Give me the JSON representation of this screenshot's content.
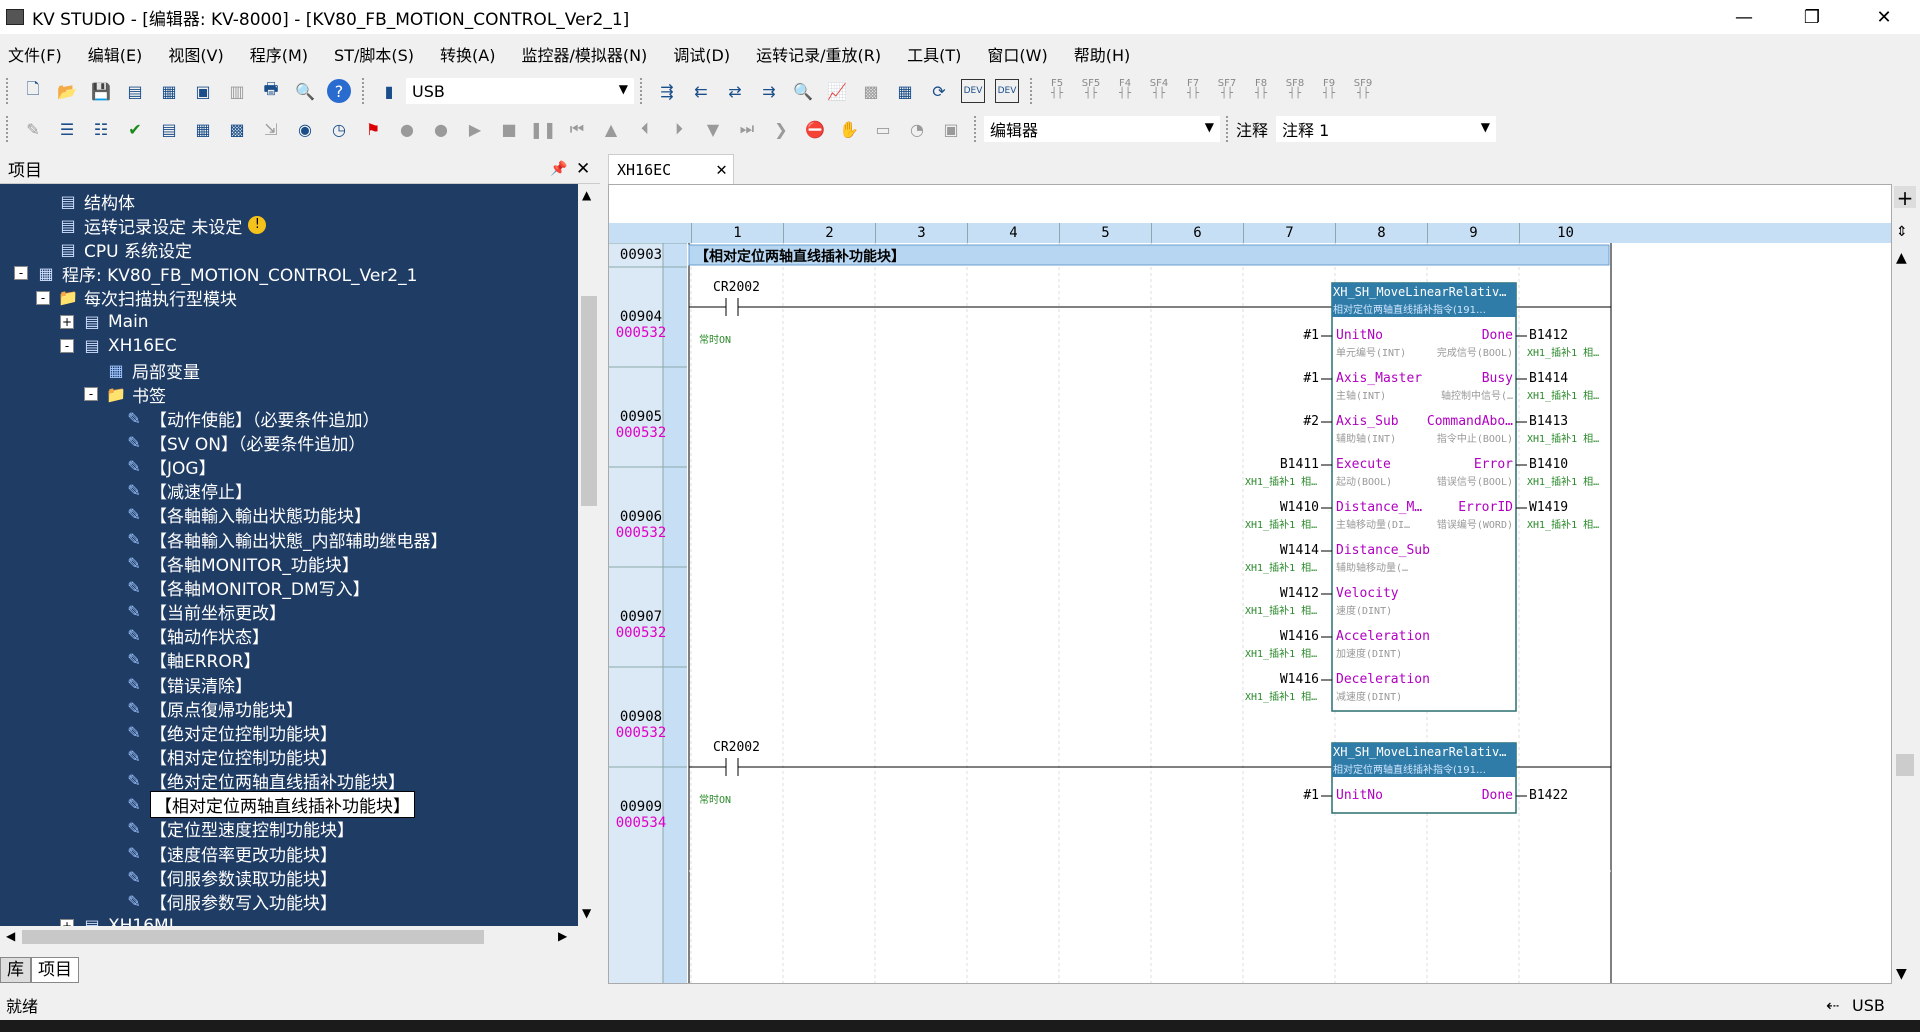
{
  "window": {
    "title": "KV STUDIO - [编辑器: KV-8000] - [KV80_FB_MOTION_CONTROL_Ver2_1]"
  },
  "menu": [
    "文件(F)",
    "编辑(E)",
    "视图(V)",
    "程序(M)",
    "ST/脚本(S)",
    "转换(A)",
    "监控器/模拟器(N)",
    "调试(D)",
    "运转记录/重放(R)",
    "工具(T)",
    "窗口(W)",
    "帮助(H)"
  ],
  "toolbar": {
    "connection": "USB",
    "fkeys": [
      "F5",
      "SF5",
      "F4",
      "SF4",
      "F7",
      "SF7",
      "F8",
      "SF8",
      "F9",
      "SF9"
    ],
    "mode_combo": "编辑器",
    "comment_label": "注释",
    "comment_combo": "注释 1"
  },
  "project": {
    "header": "项目",
    "tree": [
      {
        "label": "结构体",
        "level": 1
      },
      {
        "label": "运转记录设定  未设定",
        "level": 1,
        "warn": true
      },
      {
        "label": "CPU 系统设定",
        "level": 1
      },
      {
        "label": "程序: KV80_FB_MOTION_CONTROL_Ver2_1",
        "level": 0,
        "exp": "-"
      },
      {
        "label": "每次扫描执行型模块",
        "level": 1,
        "exp": "-"
      },
      {
        "label": "Main",
        "level": 2,
        "exp": "+"
      },
      {
        "label": "XH16EC",
        "level": 2,
        "exp": "-"
      },
      {
        "label": "局部变量",
        "level": 3
      },
      {
        "label": "书签",
        "level": 3,
        "exp": "-"
      },
      {
        "label": "【动作使能】（必要条件追加）",
        "level": 4
      },
      {
        "label": "【SV  ON】（必要条件追加）",
        "level": 4
      },
      {
        "label": "【JOG】",
        "level": 4
      },
      {
        "label": "【减速停止】",
        "level": 4
      },
      {
        "label": "【各軸輸入輸出状態功能块】",
        "level": 4
      },
      {
        "label": "【各軸輸入輸出状態_内部辅助继电器】",
        "level": 4
      },
      {
        "label": "【各軸MONITOR_功能块】",
        "level": 4
      },
      {
        "label": "【各軸MONITOR_DM写入】",
        "level": 4
      },
      {
        "label": "【当前坐标更改】",
        "level": 4
      },
      {
        "label": "【轴动作状态】",
        "level": 4
      },
      {
        "label": "【軸ERROR】",
        "level": 4
      },
      {
        "label": "【错误清除】",
        "level": 4
      },
      {
        "label": "【原点復帰功能块】",
        "level": 4
      },
      {
        "label": "【绝对定位控制功能块】",
        "level": 4
      },
      {
        "label": "【相对定位控制功能块】",
        "level": 4
      },
      {
        "label": "【绝对定位两轴直线插补功能块】",
        "level": 4
      },
      {
        "label": "【相对定位两轴直线插补功能块】",
        "level": 4,
        "selected": true
      },
      {
        "label": "【定位型速度控制功能块】",
        "level": 4
      },
      {
        "label": "【速度倍率更改功能块】",
        "level": 4
      },
      {
        "label": "【伺服参数读取功能块】",
        "level": 4
      },
      {
        "label": "【伺服参数写入功能块】",
        "level": 4
      },
      {
        "label": "XH16ML",
        "level": 2,
        "exp": "+"
      }
    ],
    "bottom_tabs": [
      "库",
      "项目"
    ]
  },
  "editor": {
    "tab": "XH16EC",
    "columns": [
      "1",
      "2",
      "3",
      "4",
      "5",
      "6",
      "7",
      "8",
      "9",
      "10"
    ],
    "rows": [
      {
        "num": "00903",
        "step": ""
      },
      {
        "num": "00904",
        "step": "000532"
      },
      {
        "num": "00905",
        "step": "000532"
      },
      {
        "num": "00906",
        "step": "000532"
      },
      {
        "num": "00907",
        "step": "000532"
      },
      {
        "num": "00908",
        "step": "000532"
      },
      {
        "num": "00909",
        "step": "000534"
      }
    ],
    "section_comment": "【相对定位两轴直线插补功能块】",
    "contact": {
      "device": "CR2002",
      "comment": "常时ON"
    },
    "fb": {
      "name": "XH_SH_MoveLinearRelativ…",
      "comment": "相对定位两轴直线插补指令(191…",
      "inputs": [
        {
          "addr": "#1",
          "pin": "UnitNo",
          "type": "单元编号(INT)",
          "acomment": ""
        },
        {
          "addr": "#1",
          "pin": "Axis_Master",
          "type": "主轴(INT)",
          "acomment": ""
        },
        {
          "addr": "#2",
          "pin": "Axis_Sub",
          "type": "辅助轴(INT)",
          "acomment": ""
        },
        {
          "addr": "B1411",
          "pin": "Execute",
          "type": "起动(BOOL)",
          "acomment": "XH1_插补1 相…"
        },
        {
          "addr": "W1410",
          "pin": "Distance_M…",
          "type": "主轴移动量(DI…",
          "acomment": "XH1_插补1 相…"
        },
        {
          "addr": "W1414",
          "pin": "Distance_Sub",
          "type": "辅助轴移动量(…",
          "acomment": "XH1_插补1 相…"
        },
        {
          "addr": "W1412",
          "pin": "Velocity",
          "type": "速度(DINT)",
          "acomment": "XH1_插补1 相…"
        },
        {
          "addr": "W1416",
          "pin": "Acceleration",
          "type": "加速度(DINT)",
          "acomment": "XH1_插补1 相…"
        },
        {
          "addr": "W1416",
          "pin": "Deceleration",
          "type": "减速度(DINT)",
          "acomment": "XH1_插补1 相…"
        }
      ],
      "outputs": [
        {
          "pin": "Done",
          "type": "完成信号(BOOL)",
          "addr": "B1412",
          "acomment": "XH1_插补1 相…"
        },
        {
          "pin": "Busy",
          "type": "轴控制中信号(…",
          "addr": "B1414",
          "acomment": "XH1_插补1 相…"
        },
        {
          "pin": "CommandAbo…",
          "type": "指令中止(BOOL)",
          "addr": "B1413",
          "acomment": "XH1_插补1 相…"
        },
        {
          "pin": "Error",
          "type": "错误信号(BOOL)",
          "addr": "B1410",
          "acomment": "XH1_插补1 相…"
        },
        {
          "pin": "ErrorID",
          "type": "错误编号(WORD)",
          "addr": "W1419",
          "acomment": "XH1_插补1 相…"
        }
      ]
    },
    "fb2": {
      "name": "XH_SH_MoveLinearRelativ…",
      "comment": "相对定位两轴直线插补指令(191…",
      "in_addr": "#1",
      "in_pin": "UnitNo",
      "out_pin": "Done",
      "out_addr": "B1422"
    }
  },
  "status": {
    "text": "就绪",
    "connection": "USB"
  }
}
